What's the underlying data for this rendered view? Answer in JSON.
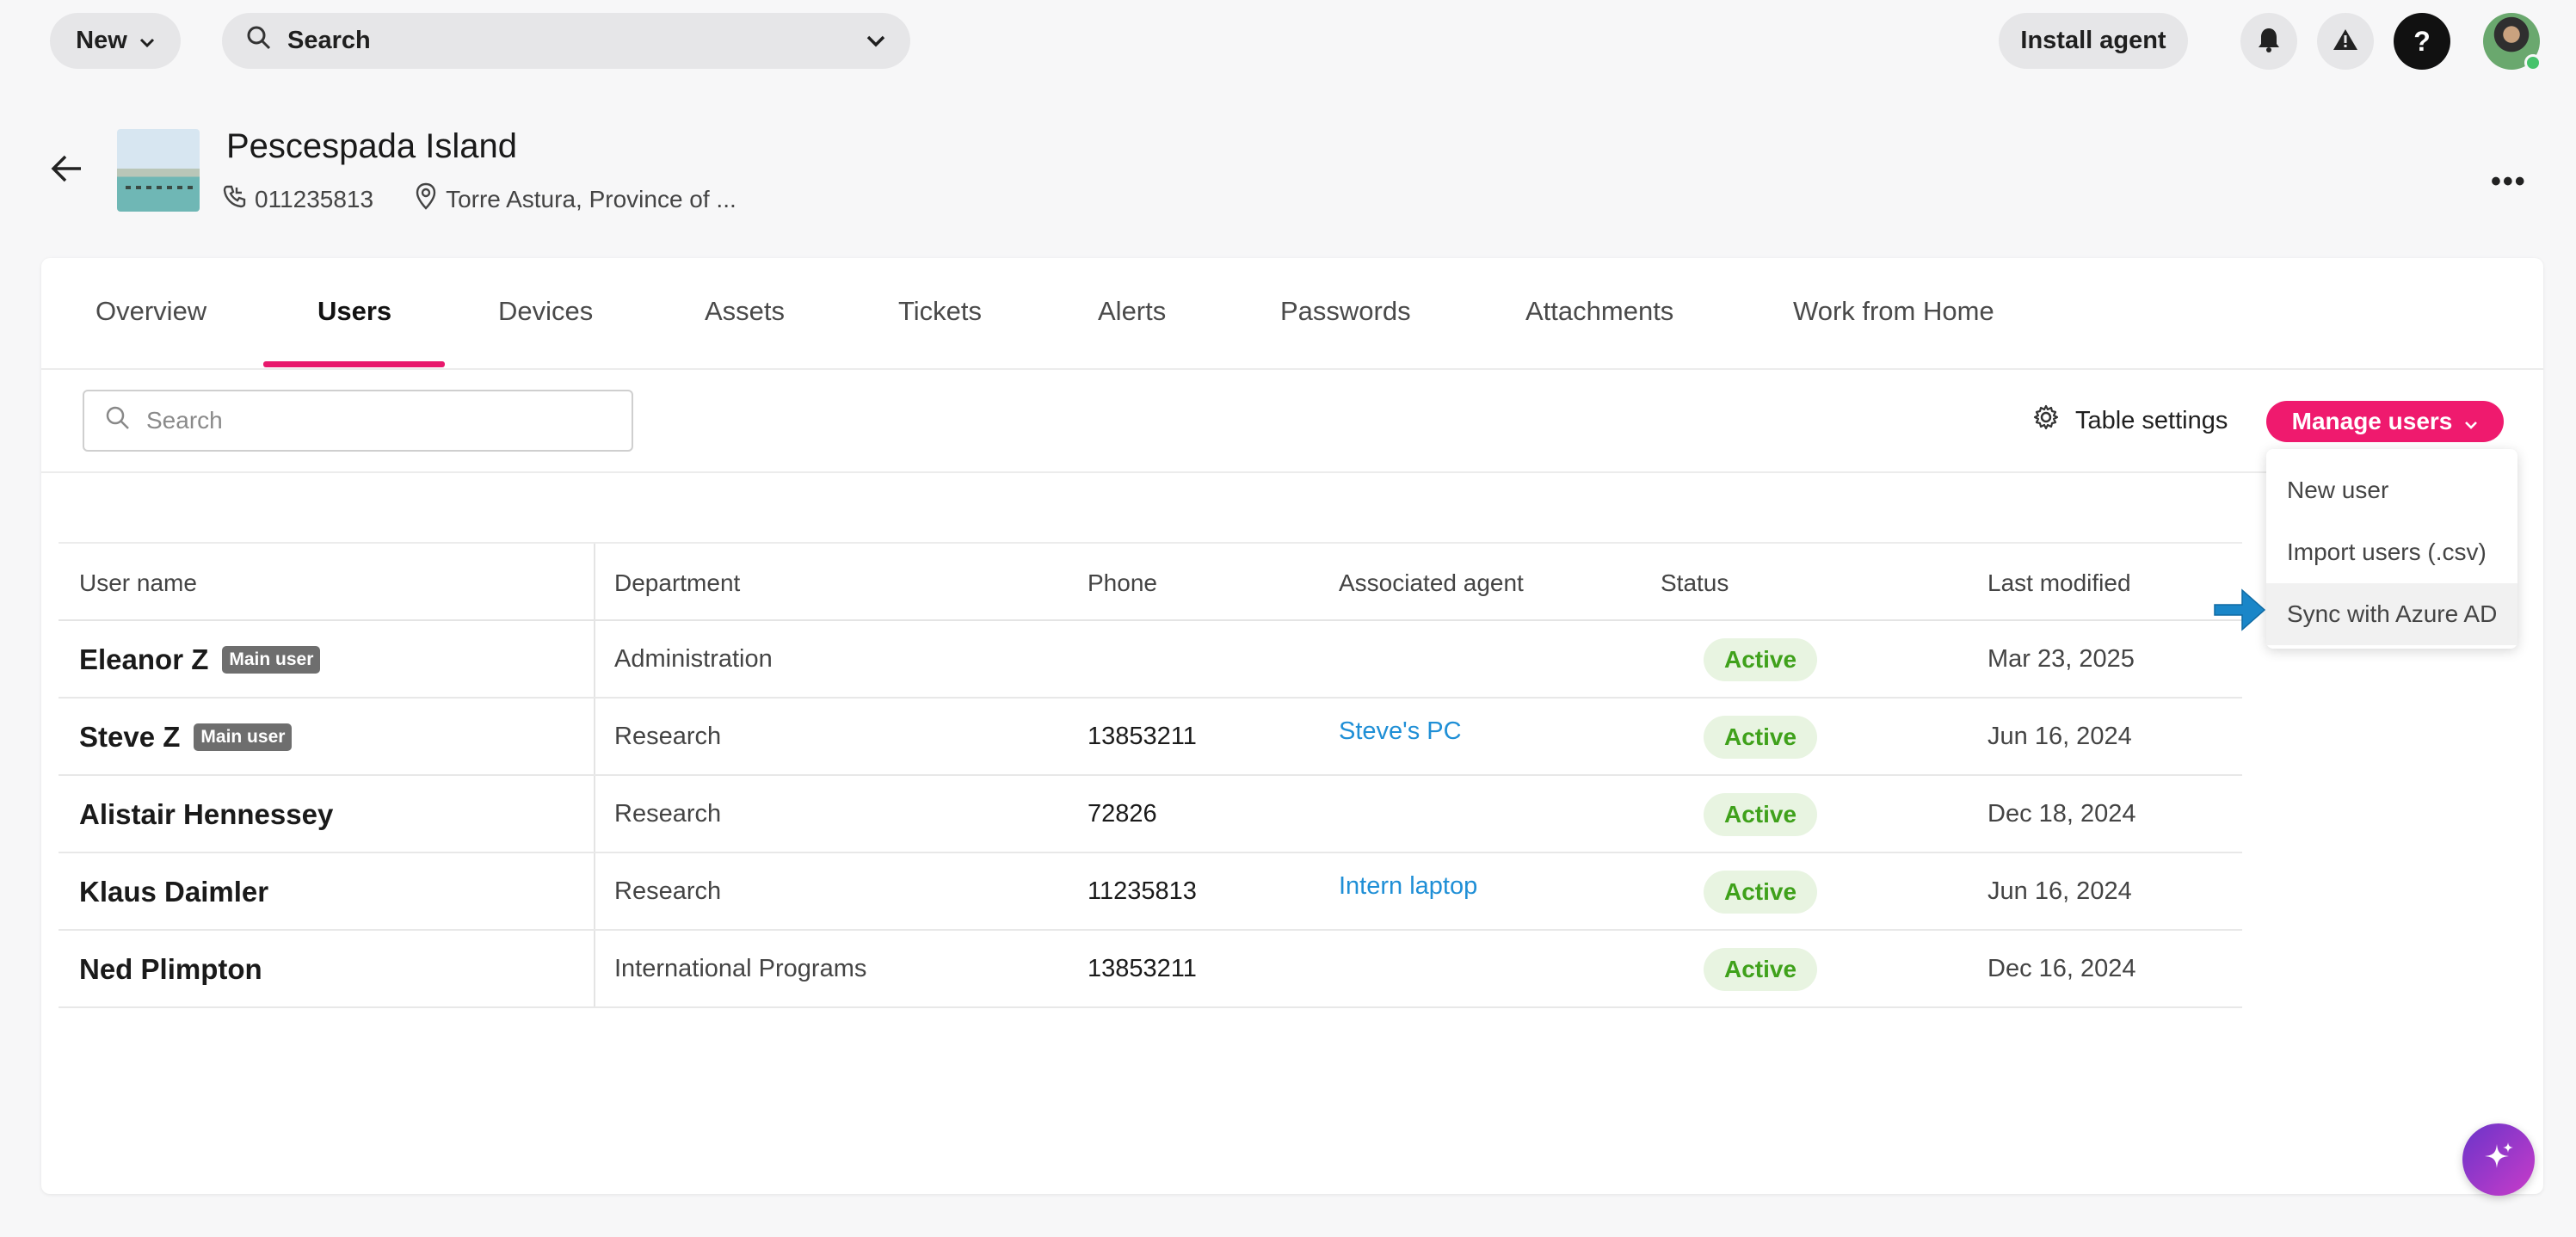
{
  "topbar": {
    "new_label": "New",
    "search_label": "Search",
    "install_label": "Install agent",
    "help_glyph": "?"
  },
  "site": {
    "title": "Pescespada Island",
    "phone": "011235813",
    "location": "Torre Astura, Province of ..."
  },
  "tabs": [
    {
      "label": "Overview"
    },
    {
      "label": "Users",
      "active": true
    },
    {
      "label": "Devices"
    },
    {
      "label": "Assets"
    },
    {
      "label": "Tickets"
    },
    {
      "label": "Alerts"
    },
    {
      "label": "Passwords"
    },
    {
      "label": "Attachments"
    },
    {
      "label": "Work from Home"
    }
  ],
  "toolbar": {
    "search_placeholder": "Search",
    "table_settings_label": "Table settings",
    "manage_users_label": "Manage users"
  },
  "manage_menu": {
    "options": [
      {
        "label": "New user"
      },
      {
        "label": "Import users (.csv)"
      },
      {
        "label": "Sync with Azure AD",
        "hover": true
      }
    ]
  },
  "table": {
    "columns": [
      "User name",
      "Department",
      "Phone",
      "Associated agent",
      "Status",
      "Last modified"
    ],
    "main_user_badge": "Main user",
    "rows": [
      {
        "name": "Eleanor Z",
        "main_user": true,
        "department": "Administration",
        "phone": "",
        "agent": "",
        "status": "Active",
        "modified": "Mar 23, 2025"
      },
      {
        "name": "Steve Z",
        "main_user": true,
        "department": "Research",
        "phone": "13853211",
        "agent": "Steve's PC",
        "status": "Active",
        "modified": "Jun 16, 2024"
      },
      {
        "name": "Alistair Hennessey",
        "main_user": false,
        "department": "Research",
        "phone": "72826",
        "agent": "",
        "status": "Active",
        "modified": "Dec 18, 2024"
      },
      {
        "name": "Klaus Daimler",
        "main_user": false,
        "department": "Research",
        "phone": "11235813",
        "agent": "Intern laptop",
        "status": "Active",
        "modified": "Jun 16, 2024"
      },
      {
        "name": "Ned Plimpton",
        "main_user": false,
        "department": "International Programs",
        "phone": "13853211",
        "agent": "",
        "status": "Active",
        "modified": "Dec 16, 2024"
      }
    ]
  },
  "colors": {
    "accent": "#ef1a6e",
    "status_text": "#3fa11b",
    "status_bg": "#e8f4e1",
    "link": "#1f8fd6",
    "pointer_arrow": "#1a86c8"
  }
}
